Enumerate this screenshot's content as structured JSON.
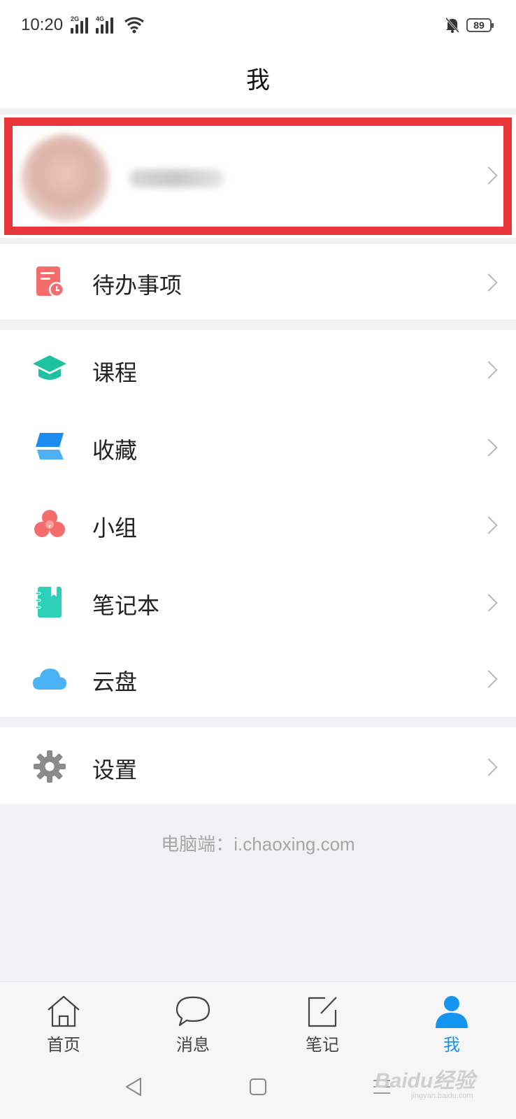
{
  "status_bar": {
    "time": "10:20",
    "signal1_label": "2G",
    "signal2_label": "4G",
    "battery": "89",
    "icons": [
      "signal-icon",
      "signal-icon",
      "wifi-icon",
      "bell-off-icon",
      "battery-icon"
    ]
  },
  "header": {
    "title": "我"
  },
  "menu": {
    "todo": {
      "label": "待办事项",
      "icon": "todo-clock-icon",
      "color": "#f56c6c"
    },
    "items": [
      {
        "label": "课程",
        "icon": "graduation-cap-icon",
        "color": "#1fc2a0"
      },
      {
        "label": "收藏",
        "icon": "bookmark-layers-icon",
        "color": "#1d8cf0"
      },
      {
        "label": "小组",
        "icon": "group-circles-icon",
        "color": "#f56c6c"
      },
      {
        "label": "笔记本",
        "icon": "notebook-icon",
        "color": "#2ccfb7"
      },
      {
        "label": "云盘",
        "icon": "cloud-icon",
        "color": "#4ab2f5"
      }
    ],
    "settings": {
      "label": "设置",
      "icon": "gear-icon",
      "color": "#8a8a8a"
    }
  },
  "footer": {
    "link_text": "电脑端：i.chaoxing.com"
  },
  "tabs": [
    {
      "label": "首页",
      "icon": "home-icon"
    },
    {
      "label": "消息",
      "icon": "chat-bubble-icon"
    },
    {
      "label": "笔记",
      "icon": "edit-note-icon"
    },
    {
      "label": "我",
      "icon": "person-icon",
      "active": true
    }
  ],
  "system_nav": [
    "back-icon",
    "home-square-icon",
    "recents-icon"
  ],
  "watermark": {
    "text": "Baidu经验",
    "sub": "jingyan.baidu.com"
  },
  "colors": {
    "accent": "#1496f0",
    "highlight": "#e8363b"
  }
}
